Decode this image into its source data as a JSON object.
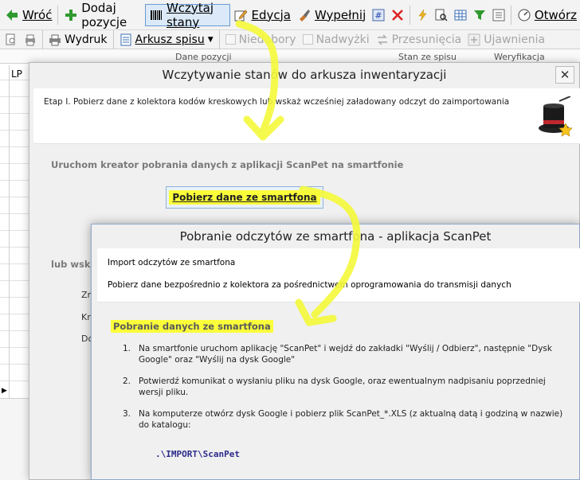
{
  "toolbar1": {
    "back": "Wróć",
    "add": "Dodaj pozycje",
    "load": "Wczytaj stany",
    "edit": "Edycja",
    "fill": "Wypełnij",
    "open": "Otwórz"
  },
  "toolbar2": {
    "print": "Wydruk",
    "sheet": "Arkusz spisu",
    "shortages": "Niedobory",
    "surpluses": "Nadwyżki",
    "moves": "Przesunięcia",
    "reveals": "Ujawnienia"
  },
  "grid": {
    "col_data": "Dane pozycji",
    "col_stock": "Stan ze spisu",
    "col_verify": "Weryfikacja",
    "lp": "LP"
  },
  "dialog1": {
    "title": "Wczytywanie stanów do arkusza inwentaryzacji",
    "close": "✕",
    "etap": "Etap I.  Pobierz dane z kolektora kodów kreskowych lub wskaż wcześniej załadowany odczyt do zaimportowania",
    "section_scanpet": "Uruchom kreator pobrania danych z aplikacji ScanPet na smartfonie",
    "button_get": "Pobierz dane ze smartfona",
    "section_other": "lub wska",
    "lbl1": "Zr",
    "lbl2": "Kre",
    "lbl3": "Do"
  },
  "dialog2": {
    "title": "Pobranie odczytów ze smartfona - aplikacja ScanPet",
    "head1": "Import odczytów ze smartfona",
    "head2": "Pobierz dane bezpośrednio z kolektora za pośrednictwem oprogramowania do transmisji danych",
    "section": "Pobranie danych ze smartfona",
    "steps": [
      {
        "n": "1.",
        "text": "Na smartfonie uruchom aplikację \"ScanPet\" i wejdź do zakładki \"Wyślij / Odbierz\", następnie \"Dysk Google\" oraz \"Wyślij na dysk Google\""
      },
      {
        "n": "2.",
        "text": "Potwierdź komunikat o wysłaniu pliku na dysk Google, oraz ewentualnym nadpisaniu poprzedniej wersji pliku."
      },
      {
        "n": "3.",
        "text": "Na komputerze otwórz dysk Google i pobierz plik ScanPet_*.XLS (z aktualną datą i godziną w nazwie) do katalogu:"
      }
    ],
    "path": ".\\IMPORT\\ScanPet"
  },
  "colors": {
    "highlight": "#fbff3a",
    "accent": "#6b9bd1"
  }
}
